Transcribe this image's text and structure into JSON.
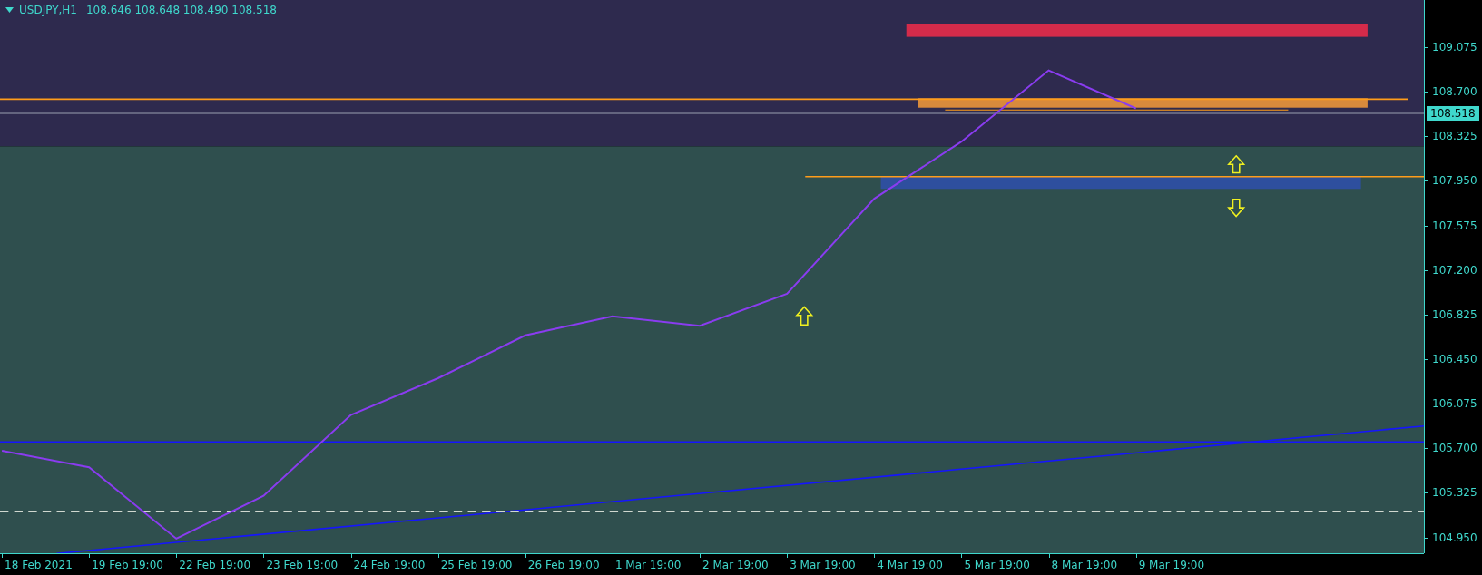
{
  "chart_header": {
    "symbol": "USDJPY,H1",
    "ohlc": "108.646 108.648 108.490 108.518"
  },
  "price_tag": "108.518",
  "chart_data": {
    "type": "line",
    "categories": [
      "18 Feb 2021",
      "19 Feb 19:00",
      "22 Feb 19:00",
      "23 Feb 19:00",
      "24 Feb 19:00",
      "25 Feb 19:00",
      "26 Feb 19:00",
      "1 Mar 19:00",
      "2 Mar 19:00",
      "3 Mar 19:00",
      "4 Mar 19:00",
      "5 Mar 19:00",
      "8 Mar 19:00",
      "9 Mar 19:00"
    ],
    "series": [
      {
        "color": "#8a3cf0",
        "values": [
          105.68,
          105.54,
          104.94,
          105.3,
          105.98,
          106.29,
          106.65,
          106.81,
          106.73,
          107.0,
          107.8,
          108.28,
          108.88,
          108.56
        ]
      }
    ],
    "ylim": [
      104.817,
      109.472
    ],
    "yticks": [
      {
        "value": 109.075,
        "label": "109.075"
      },
      {
        "value": 108.7,
        "label": "108.700"
      },
      {
        "value": 108.325,
        "label": "108.325"
      },
      {
        "value": 107.95,
        "label": "107.950"
      },
      {
        "value": 107.575,
        "label": "107.575"
      },
      {
        "value": 107.2,
        "label": "107.200"
      },
      {
        "value": 106.825,
        "label": "106.825"
      },
      {
        "value": 106.45,
        "label": "106.450"
      },
      {
        "value": 106.075,
        "label": "106.075"
      },
      {
        "value": 105.7,
        "label": "105.700"
      },
      {
        "value": 105.325,
        "label": "105.325"
      },
      {
        "value": 104.95,
        "label": "104.950"
      }
    ]
  }
}
